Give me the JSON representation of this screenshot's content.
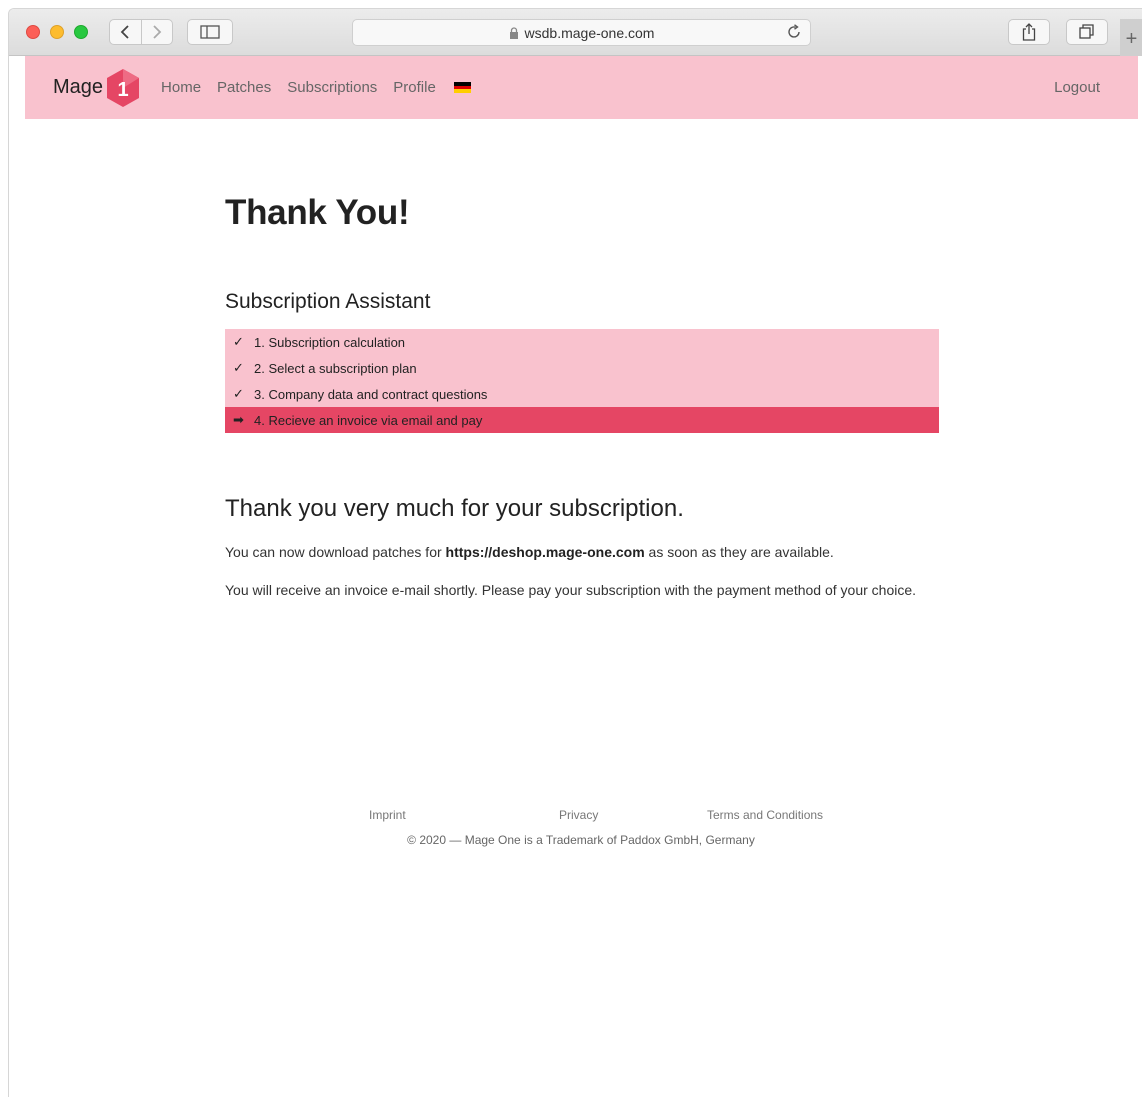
{
  "browser": {
    "url": "wsdb.mage-one.com",
    "icons": [
      "back-icon",
      "forward-icon",
      "sidebar-icon",
      "lock-icon",
      "reload-icon",
      "share-icon",
      "tabs-icon",
      "new-tab-icon"
    ]
  },
  "navbar": {
    "brand_text": "Mage",
    "brand_badge": "1",
    "links": [
      "Home",
      "Patches",
      "Subscriptions",
      "Profile"
    ],
    "logout": "Logout",
    "colors": {
      "navbar_bg": "#f9c2ce",
      "badge": "#e54664"
    }
  },
  "main": {
    "title": "Thank You!",
    "assistant_title": "Subscription Assistant",
    "steps": [
      {
        "mark": "✓",
        "label": "1. Subscription calculation",
        "state": "done"
      },
      {
        "mark": "✓",
        "label": "2. Select a subscription plan",
        "state": "done"
      },
      {
        "mark": "✓",
        "label": "3. Company data and contract questions",
        "state": "done"
      },
      {
        "mark": "➡",
        "label": "4. Recieve an invoice via email and pay",
        "state": "active"
      }
    ],
    "thanks_heading": "Thank you very much for your subscription.",
    "para1_prefix": "You can now download patches for ",
    "para1_shop": "https://deshop.mage-one.com",
    "para1_suffix": " as soon as they are available.",
    "para2": "You will receive an invoice e-mail shortly. Please pay your subscription with the payment method of your choice."
  },
  "footer": {
    "imprint": "Imprint",
    "privacy": "Privacy",
    "terms": "Terms and Conditions",
    "copyright": "© 2020 — Mage One is a Trademark of Paddox GmbH, Germany"
  }
}
